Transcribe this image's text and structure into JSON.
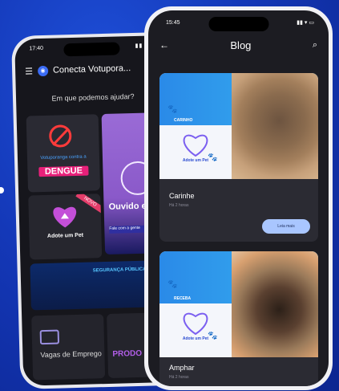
{
  "back_phone": {
    "status_time": "17:40",
    "status_icons": "▮▮ ▾ ▭",
    "app_title": "Conecta Votupora...",
    "help_text": "Em que podemos ajudar?",
    "tiles": {
      "dengue_sub": "Votuporanga contra a",
      "dengue_label": "DENGUE",
      "adote_label": "Adote um Pet",
      "novo_badge": "NOVO",
      "ouvidoria_label": "Ouvido e Servi",
      "ouvidoria_strip": "Fale com a gente",
      "banner_text": "SEGURANÇA PÚBLICA",
      "vagas_label": "Vagas de Emprego",
      "prod_label": "PRODO"
    }
  },
  "front_phone": {
    "status_time": "15:45",
    "status_icons": "▮▮ ▾ ▭",
    "header_title": "Blog",
    "cards": [
      {
        "badge": "CARINHO",
        "title": "Carinhe",
        "meta": "Há 2 horas",
        "button": "Leia mais"
      },
      {
        "badge": "RECEBA",
        "title": "Amphar",
        "meta": "Há 2 horas",
        "button": ""
      }
    ],
    "adote_mini_label": "Adote um Pet"
  },
  "colors": {
    "background": "#1438b8",
    "accent_pink": "#e8207a",
    "button_blue": "#a9c6ff"
  },
  "icons": [
    "menu-icon",
    "app-logo-icon",
    "back-arrow-icon",
    "search-icon",
    "heart-icon",
    "paw-icon",
    "no-mosquito-icon",
    "bag-icon"
  ]
}
